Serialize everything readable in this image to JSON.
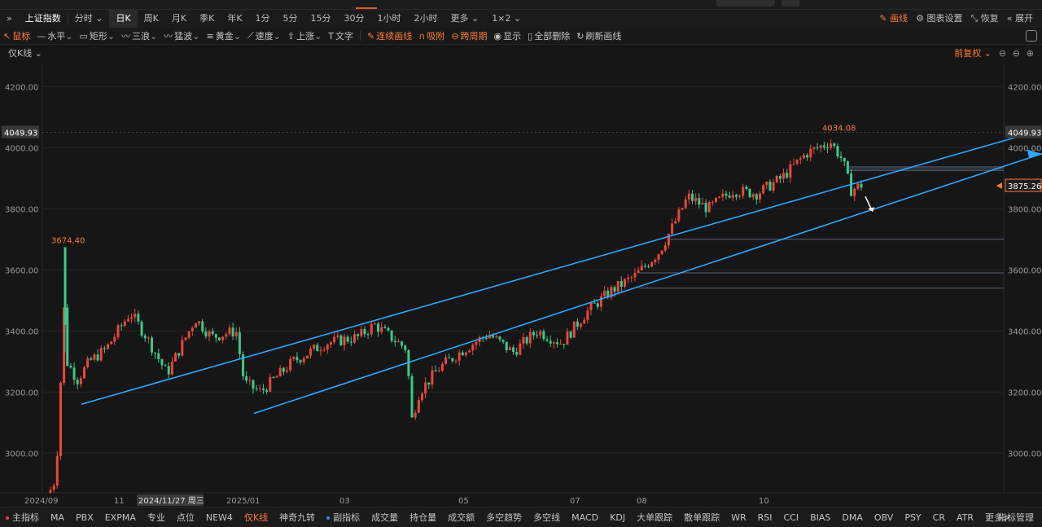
{
  "top_tabs": {
    "active_index": 7
  },
  "toolbar": {
    "collapse_icon": "double-chevron-right-icon",
    "instrument": "上证指数",
    "periods": [
      "分时",
      "日K",
      "周K",
      "月K",
      "季K",
      "年K",
      "1分",
      "5分",
      "15分",
      "30分",
      "1小时",
      "2小时",
      "更多",
      "1×2"
    ],
    "active_period": "日K",
    "draw_label": "画线",
    "settings_label": "图表设置",
    "restore_label": "恢复",
    "expand_label": "展开"
  },
  "draw_tools": {
    "items": [
      {
        "label": "鼠标",
        "icon": "cursor-icon",
        "orange": true
      },
      {
        "label": "水平",
        "icon": "horizontal-line-icon"
      },
      {
        "label": "矩形",
        "icon": "rectangle-icon"
      },
      {
        "label": "三浪",
        "icon": "wave-icon"
      },
      {
        "label": "猛波",
        "icon": "wave-icon"
      },
      {
        "label": "黄金",
        "icon": "golden-ratio-icon"
      },
      {
        "label": "速度",
        "icon": "speed-line-icon"
      },
      {
        "label": "上涨",
        "icon": "up-arrow-icon"
      },
      {
        "label": "文字",
        "icon": "text-icon"
      }
    ],
    "actions": [
      {
        "label": "连续画线",
        "icon": "pencil-icon",
        "orange": true
      },
      {
        "label": "吸附",
        "icon": "magnet-icon",
        "orange": true
      },
      {
        "label": "跨周期",
        "icon": "cross-period-icon",
        "orange": true
      },
      {
        "label": "显示",
        "icon": "eye-icon"
      },
      {
        "label": "全部删除",
        "icon": "trash-icon"
      },
      {
        "label": "刷新画线",
        "icon": "refresh-icon"
      }
    ]
  },
  "chart_header": {
    "indicator": "仅K线",
    "adjust": "前复权"
  },
  "chart_data": {
    "type": "candlestick",
    "y_ticks": [
      "4200.00",
      "4000.00",
      "3800.00",
      "3600.00",
      "3400.00",
      "3200.00",
      "3000.00"
    ],
    "ylim": [
      2870,
      4270
    ],
    "x_ticks": [
      "2024/09",
      "11",
      "2024/11/27 周三",
      "2025/01",
      "03",
      "05",
      "07",
      "08",
      "10"
    ],
    "current_price_label": "4049.93",
    "last_price_label": "3875.26",
    "high_label": "4034.08",
    "early_high_label": "3674.40",
    "colors": {
      "up": "#e8473a",
      "down": "#3cc88a",
      "trendline": "#2ea8ff",
      "hline": "#5a6374"
    },
    "trendlines": [
      {
        "from": [
          0,
          3160
        ],
        "to": [
          1.0,
          4062
        ]
      },
      {
        "from": [
          0.2,
          3130
        ],
        "to": [
          1.0,
          3980
        ]
      }
    ],
    "hlines": [
      3937,
      3925,
      3700,
      3590,
      3540
    ],
    "candles": [
      [
        2.0,
        2870,
        2880,
        2860
      ],
      [
        2.0,
        2880,
        2960,
        2880
      ],
      [
        2.0,
        3090,
        3090,
        3030
      ],
      [
        2.0,
        3265,
        3310,
        3200
      ],
      [
        2.0,
        3674,
        3674,
        3320
      ],
      [
        2.0,
        3350,
        3400,
        3230
      ],
      [
        2.0,
        3280,
        3320,
        3210
      ],
      [
        2.0,
        3255,
        3290,
        3200
      ],
      [
        2.0,
        3210,
        3280,
        3160
      ],
      [
        2.0,
        3300,
        3350,
        3250
      ],
      [
        2.0,
        3310,
        3330,
        3270
      ],
      [
        2.0,
        3320,
        3360,
        3290
      ],
      [
        2.0,
        3300,
        3340,
        3260
      ],
      [
        2.0,
        3310,
        3340,
        3280
      ],
      [
        2.0,
        3340,
        3360,
        3300
      ],
      [
        2.0,
        3350,
        3380,
        3310
      ]
    ]
  },
  "bottom": {
    "items": [
      {
        "label": "主指标",
        "dot": "#e8473a"
      },
      {
        "label": "MA"
      },
      {
        "label": "PBX"
      },
      {
        "label": "EXPMA"
      },
      {
        "label": "专业"
      },
      {
        "label": "点位"
      },
      {
        "label": "NEW4"
      },
      {
        "label": "仅K线",
        "orange": true
      },
      {
        "label": "神奇九转"
      },
      {
        "label": "副指标",
        "dot": "#2e8bff"
      },
      {
        "label": "成交量"
      },
      {
        "label": "持仓量"
      },
      {
        "label": "成交额"
      },
      {
        "label": "多空趋势"
      },
      {
        "label": "多空线"
      },
      {
        "label": "MACD"
      },
      {
        "label": "KDJ"
      },
      {
        "label": "大单跟踪"
      },
      {
        "label": "散单跟踪"
      },
      {
        "label": "WR"
      },
      {
        "label": "RSI"
      },
      {
        "label": "CCI"
      },
      {
        "label": "BIAS"
      },
      {
        "label": "DMA"
      },
      {
        "label": "OBV"
      },
      {
        "label": "PSY"
      },
      {
        "label": "CR"
      },
      {
        "label": "ATR"
      },
      {
        "label": "更多>"
      }
    ],
    "manage_label": "指标管理"
  }
}
